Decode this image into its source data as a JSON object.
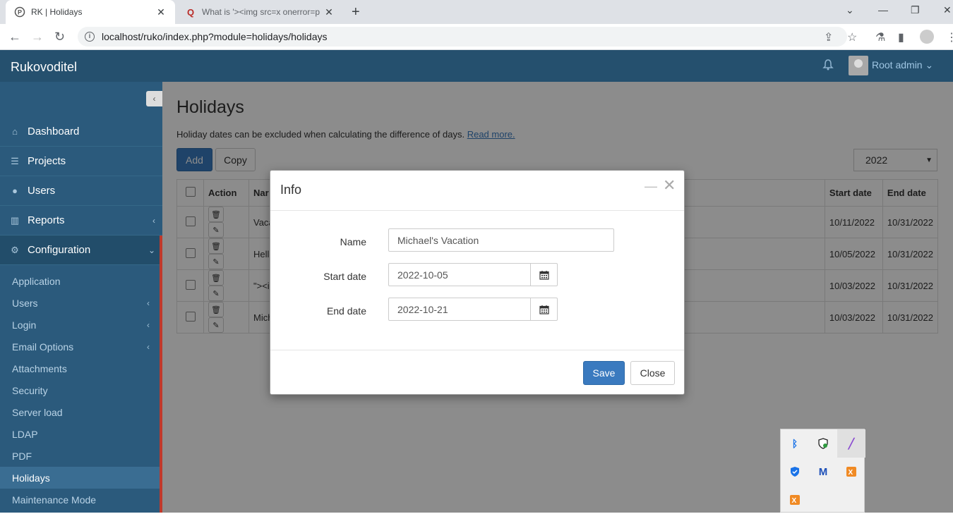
{
  "browser": {
    "tabs": [
      {
        "title": "RK | Holidays",
        "icon": "rk-icon"
      },
      {
        "title": "What is '><img src=x onerror=p",
        "icon": "quora-icon"
      }
    ],
    "url": "localhost/ruko/index.php?module=holidays/holidays"
  },
  "app": {
    "brand": "Rukovoditel",
    "user": "Root admin"
  },
  "sidebar": {
    "items": [
      {
        "label": "Dashboard",
        "icon": "home-icon"
      },
      {
        "label": "Projects",
        "icon": "list-icon"
      },
      {
        "label": "Users",
        "icon": "user-icon"
      },
      {
        "label": "Reports",
        "icon": "bar-chart-icon"
      },
      {
        "label": "Configuration",
        "icon": "gear-icon"
      }
    ],
    "subitems": [
      {
        "label": "Application"
      },
      {
        "label": "Users"
      },
      {
        "label": "Login"
      },
      {
        "label": "Email Options"
      },
      {
        "label": "Attachments"
      },
      {
        "label": "Security"
      },
      {
        "label": "Server load"
      },
      {
        "label": "LDAP"
      },
      {
        "label": "PDF"
      },
      {
        "label": "Holidays"
      },
      {
        "label": "Maintenance Mode"
      }
    ]
  },
  "page": {
    "title": "Holidays",
    "description": "Holiday dates can be excluded when calculating the difference of days.",
    "read_more": "Read more.",
    "add_label": "Add",
    "copy_label": "Copy",
    "year": "2022"
  },
  "table": {
    "headers": {
      "action": "Action",
      "name": "Nar",
      "start": "Start date",
      "end": "End date"
    },
    "rows": [
      {
        "name": "Vaca",
        "start": "10/11/2022",
        "end": "10/31/2022"
      },
      {
        "name": "Hello",
        "start": "10/05/2022",
        "end": "10/31/2022"
      },
      {
        "name": "\"><i",
        "start": "10/03/2022",
        "end": "10/31/2022"
      },
      {
        "name": "Mich",
        "start": "10/03/2022",
        "end": "10/31/2022"
      }
    ]
  },
  "modal": {
    "title": "Info",
    "name_label": "Name",
    "name_value": "Michael's Vacation",
    "start_label": "Start date",
    "start_value": "2022-10-05",
    "end_label": "End date",
    "end_value": "2022-10-21",
    "save_label": "Save",
    "close_label": "Close"
  },
  "colors": {
    "header": "#25506e",
    "sidebar": "#2b5a7c",
    "primary": "#3a7abf"
  }
}
